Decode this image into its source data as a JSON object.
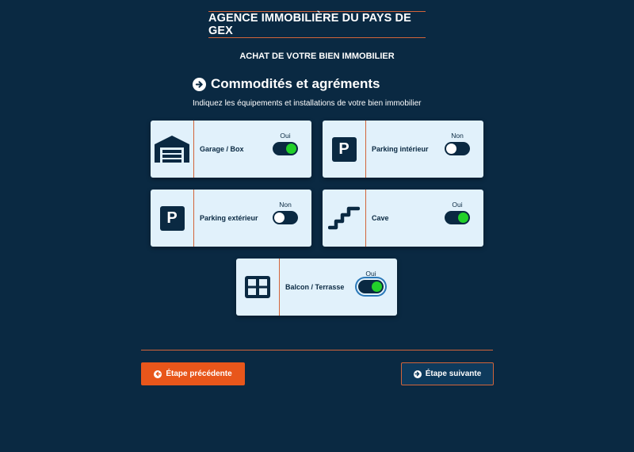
{
  "header": {
    "agency_title": "AGENCE IMMOBILIÈRE DU PAYS DE GEX",
    "subtitle": "ACHAT DE VOTRE BIEN IMMOBILIER"
  },
  "section": {
    "title": "Commodités et agréments",
    "description": "Indiquez les équipements et installations de votre bien immobilier"
  },
  "amenities": [
    {
      "label": "Garage / Box",
      "state": "Oui",
      "on": true,
      "icon": "garage-icon"
    },
    {
      "label": "Parking intérieur",
      "state": "Non",
      "on": false,
      "icon": "parking-icon"
    },
    {
      "label": "Parking extérieur",
      "state": "Non",
      "on": false,
      "icon": "parking-icon"
    },
    {
      "label": "Cave",
      "state": "Oui",
      "on": true,
      "icon": "stairs-icon"
    },
    {
      "label": "Balcon / Terrasse",
      "state": "Oui",
      "on": true,
      "icon": "window-icon"
    }
  ],
  "parking_letter": "P",
  "nav": {
    "prev_label": "Étape précédente",
    "next_label": "Étape suivante"
  },
  "colors": {
    "background": "#0a2942",
    "accent": "#d2643a",
    "prev_button": "#e8561b",
    "card": "#e1f1fb",
    "toggle_on": "#22d02a"
  }
}
